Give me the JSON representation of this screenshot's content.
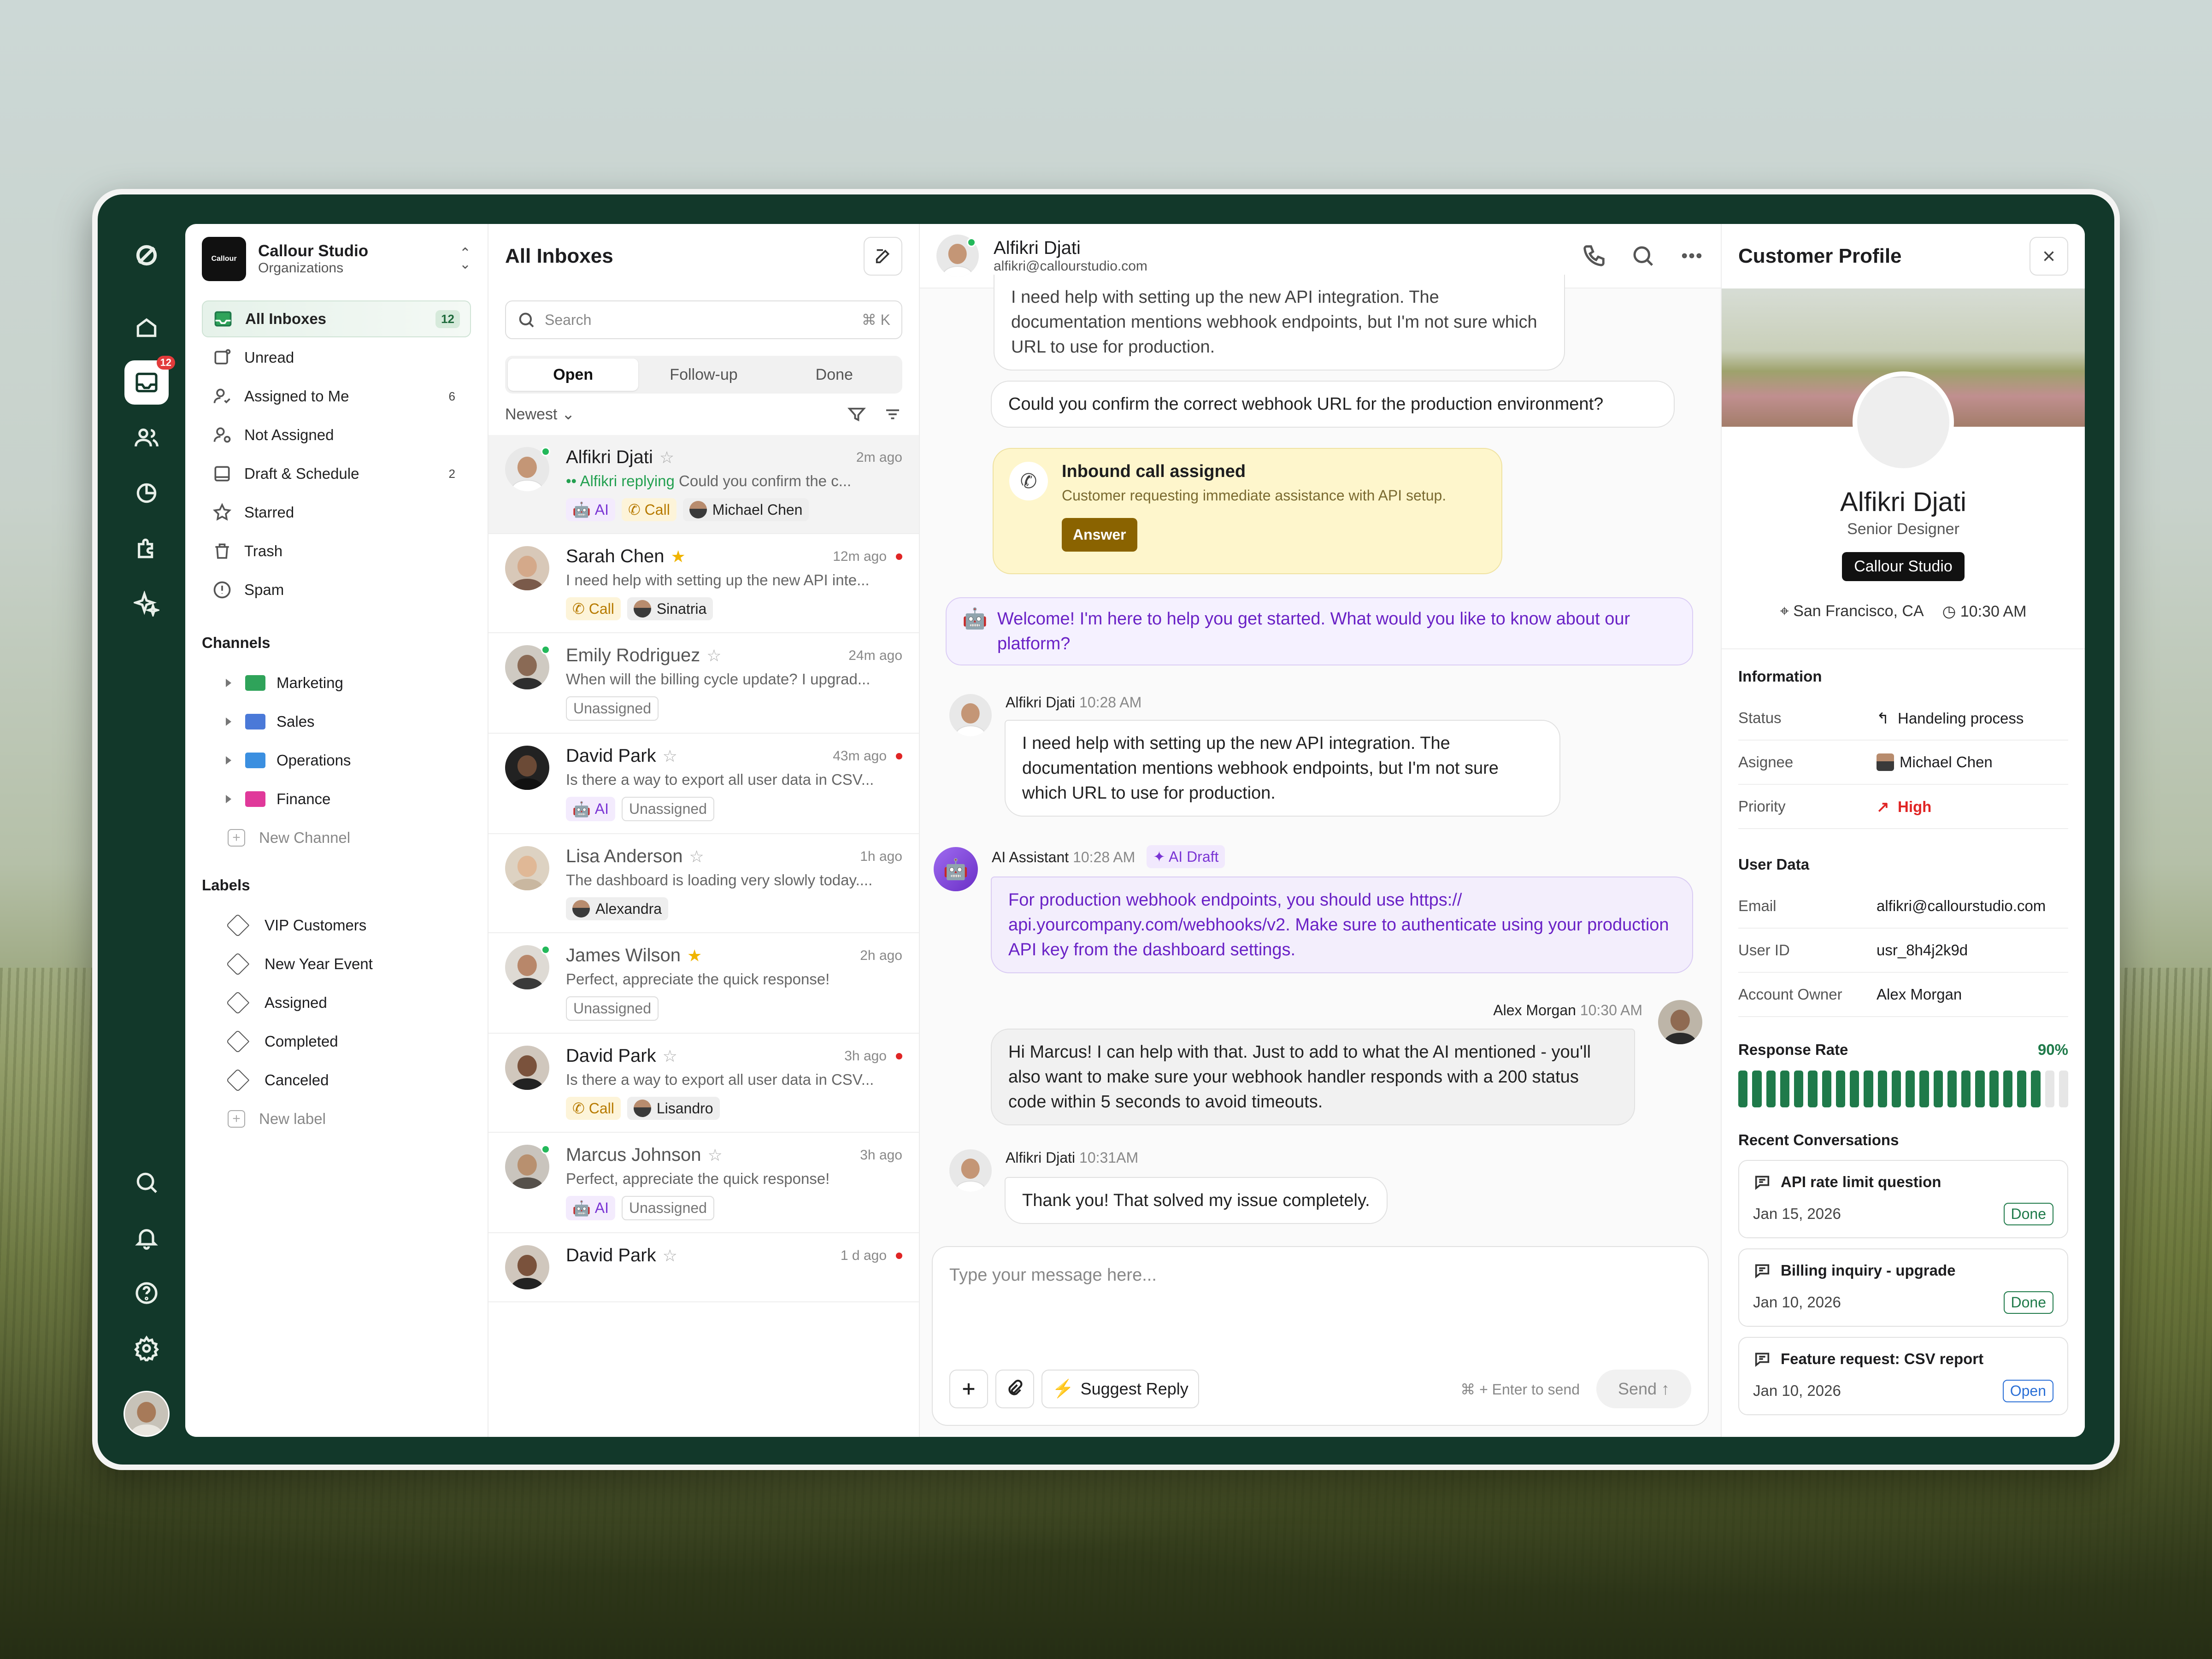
{
  "org": {
    "logo": "Callour",
    "name": "Callour Studio",
    "sub": "Organizations"
  },
  "rail": {
    "inbox_badge": "12"
  },
  "nav": [
    {
      "label": "All Inboxes",
      "count": "12"
    },
    {
      "label": "Unread",
      "count": ""
    },
    {
      "label": "Assigned to Me",
      "count": "6"
    },
    {
      "label": "Not Assigned",
      "count": ""
    },
    {
      "label": "Draft & Schedule",
      "count": "2"
    },
    {
      "label": "Starred",
      "count": ""
    },
    {
      "label": "Trash",
      "count": ""
    },
    {
      "label": "Spam",
      "count": ""
    }
  ],
  "channels": {
    "title": "Channels",
    "items": [
      {
        "label": "Marketing",
        "color": "#2fa35a"
      },
      {
        "label": "Sales",
        "color": "#4a79d8"
      },
      {
        "label": "Operations",
        "color": "#3b8fe0"
      },
      {
        "label": "Finance",
        "color": "#e0399a"
      }
    ],
    "new": "New Channel"
  },
  "labels": {
    "title": "Labels",
    "items": [
      "VIP Customers",
      "New Year Event",
      "Assigned",
      "Completed",
      "Canceled"
    ],
    "new": "New label"
  },
  "list": {
    "title": "All Inboxes",
    "search_placeholder": "Search",
    "search_kbd": "⌘ K",
    "tabs": [
      "Open",
      "Follow-up",
      "Done"
    ],
    "sort": "Newest"
  },
  "conversations": [
    {
      "name": "Alfikri Djati",
      "ago": "2m ago",
      "preview_status": "Alfikri replying",
      "preview": "Could you confirm the c...",
      "chips": [
        "AI",
        "Call",
        "Michael Chen"
      ]
    },
    {
      "name": "Sarah Chen",
      "ago": "12m ago",
      "preview": "I need help with setting up the new API inte...",
      "chips": [
        "Call",
        "Sinatria"
      ]
    },
    {
      "name": "Emily Rodriguez",
      "ago": "24m ago",
      "preview": "When will the billing cycle update? I upgrad...",
      "chips": [
        "Unassigned"
      ]
    },
    {
      "name": "David Park",
      "ago": "43m ago",
      "preview": "Is there a way to export all user data in CSV...",
      "chips": [
        "AI",
        "Unassigned"
      ]
    },
    {
      "name": "Lisa Anderson",
      "ago": "1h ago",
      "preview": "The dashboard is loading very slowly today....",
      "chips": [
        "Alexandra"
      ]
    },
    {
      "name": "James Wilson",
      "ago": "2h ago",
      "preview": "Perfect, appreciate the quick response!",
      "chips": [
        "Unassigned"
      ]
    },
    {
      "name": "David Park",
      "ago": "3h ago",
      "preview": "Is there a way to export all user data in CSV...",
      "chips": [
        "Call",
        "Lisandro"
      ]
    },
    {
      "name": "Marcus Johnson",
      "ago": "3h ago",
      "preview": "Perfect, appreciate the quick response!",
      "chips": [
        "AI",
        "Unassigned"
      ]
    },
    {
      "name": "David Park",
      "ago": "1 d ago",
      "preview": "",
      "chips": []
    }
  ],
  "chat": {
    "name": "Alfikri Djati",
    "email": "alfikri@callourstudio.com",
    "partial": "I need help with setting up the new API integration. The documentation mentions webhook endpoints, but I'm not sure which URL to use for production.",
    "question": "Could you confirm the correct webhook URL for the production environment?",
    "call_title": "Inbound call assigned",
    "call_sub": "Customer requesting immediate assistance with API setup.",
    "answer": "Answer",
    "welcome": "Welcome! I'm here to help you get started. What would you like to know about our platform?",
    "m1_name": "Alfikri Djati",
    "m1_time": "10:28 AM",
    "m1": "I need help with setting up the new API integration. The documentation mentions webhook endpoints, but I'm not sure which URL to use for production.",
    "ai_name": "AI Assistant",
    "ai_time": "10:28 AM",
    "ai_draft": "AI Draft",
    "ai_msg": "For production webhook endpoints, you should use https:// api.yourcompany.com/webhooks/v2. Make sure to authenticate using your production API key from the dashboard settings.",
    "m2_name": "Alex Morgan",
    "m2_time": "10:30 AM",
    "m2": "Hi Marcus! I can help with that. Just to add to what the AI mentioned - you'll also want to make sure your webhook handler responds with a 200 status code within 5 seconds to avoid timeouts.",
    "m3_name": "Alfikri Djati",
    "m3_time": "10:31AM",
    "m3": "Thank you! That solved my issue completely.",
    "placeholder": "Type your message here...",
    "suggest": "Suggest Reply",
    "hint": "⌘ + Enter to send",
    "send": "Send"
  },
  "profile": {
    "title": "Customer Profile",
    "name": "Alfikri Djati",
    "role": "Senior Designer",
    "company": "Callour Studio",
    "location": "San Francisco, CA",
    "time": "10:30 AM",
    "info_title": "Information",
    "status_k": "Status",
    "status_v": "Handeling process",
    "assignee_k": "Asignee",
    "assignee_v": "Michael Chen",
    "priority_k": "Priority",
    "priority_v": "High",
    "ud_title": "User Data",
    "email_k": "Email",
    "email_v": "alfikri@callourstudio.com",
    "uid_k": "User ID",
    "uid_v": "usr_8h4j2k9d",
    "owner_k": "Account Owner",
    "owner_v": "Alex Morgan",
    "rate_title": "Response Rate",
    "rate_value": "90%",
    "rate_fraction": 0.9,
    "recent_title": "Recent Conversations",
    "recent": [
      {
        "title": "API rate limit question",
        "date": "Jan 15, 2026",
        "status": "Done"
      },
      {
        "title": "Billing inquiry - upgrade",
        "date": "Jan 10, 2026",
        "status": "Done"
      },
      {
        "title": "Feature request: CSV report",
        "date": "Jan 10, 2026",
        "status": "Open"
      }
    ]
  },
  "colors": {
    "rail": "#12382a",
    "accent_green": "#1f7a4a",
    "ai_purple": "#7a34d4",
    "high_red": "#e02525"
  }
}
